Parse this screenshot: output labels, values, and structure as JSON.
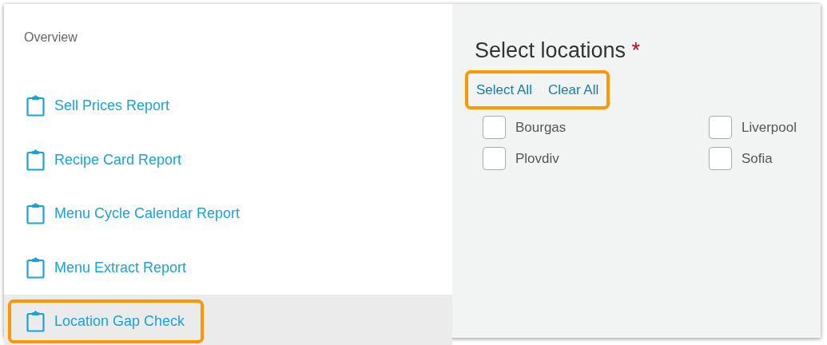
{
  "sidebar": {
    "heading": "Overview",
    "items": [
      {
        "label": "Sell Prices Report",
        "selected": false,
        "highlighted": false
      },
      {
        "label": "Recipe Card Report",
        "selected": false,
        "highlighted": false
      },
      {
        "label": "Menu Cycle Calendar Report",
        "selected": false,
        "highlighted": false
      },
      {
        "label": "Menu Extract Report",
        "selected": false,
        "highlighted": false
      },
      {
        "label": "Location Gap Check",
        "selected": true,
        "highlighted": true
      }
    ]
  },
  "panel": {
    "title": "Select locations",
    "required_mark": "*",
    "links_highlighted": true,
    "links": [
      "Select All",
      "Clear All"
    ],
    "locations": [
      {
        "name": "Bourgas",
        "checked": false
      },
      {
        "name": "Liverpool",
        "checked": false
      },
      {
        "name": "Plovdiv",
        "checked": false
      },
      {
        "name": "Sofia",
        "checked": false
      }
    ]
  }
}
